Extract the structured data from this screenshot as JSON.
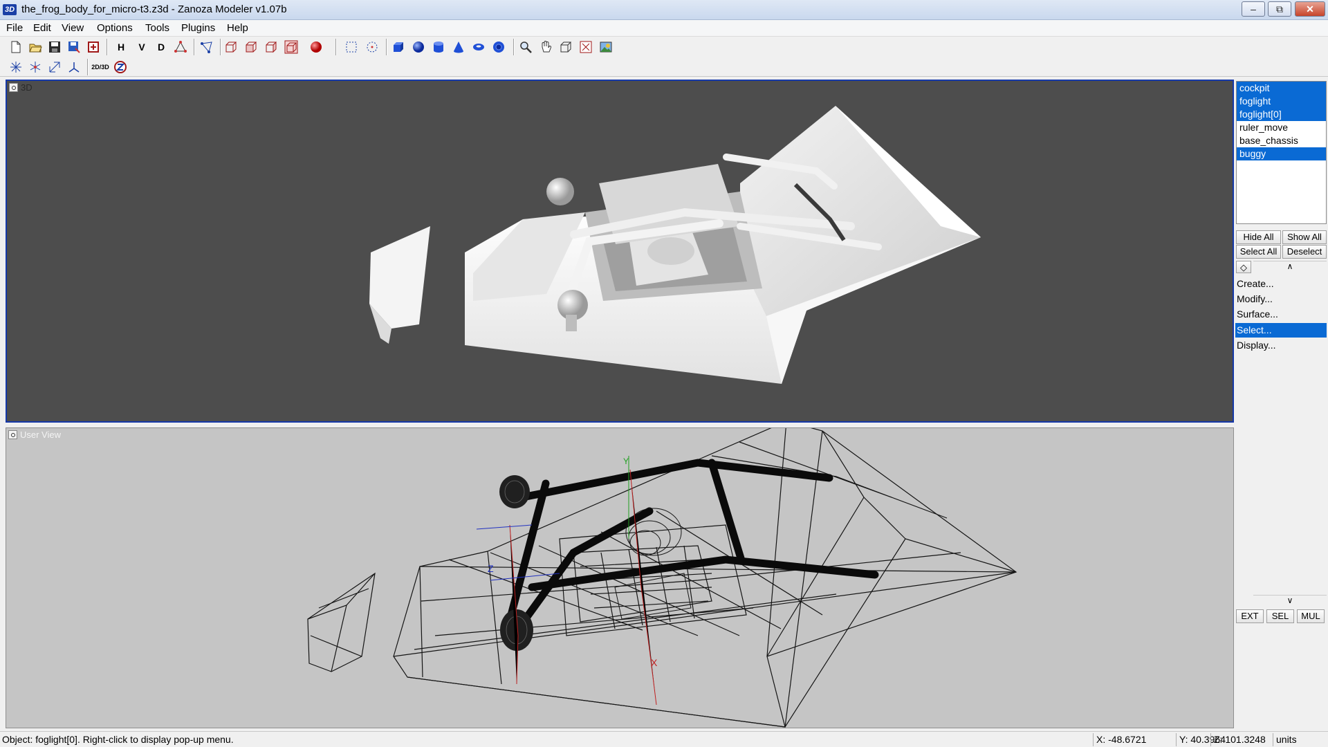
{
  "window": {
    "app_icon": "3D",
    "title": "the_frog_body_for_micro-t3.z3d - Zanoza Modeler v1.07b",
    "controls": [
      "minimize-icon",
      "restore-icon",
      "close-icon"
    ]
  },
  "menu": {
    "items": [
      "File",
      "Edit",
      "View",
      "Options",
      "Tools",
      "Plugins",
      "Help"
    ]
  },
  "toolbar1": {
    "h_label": "H",
    "v_label": "V",
    "d_label": "D",
    "icons": [
      "new-file-icon",
      "open-file-icon",
      "save-icon",
      "save-as-icon",
      "revert-icon",
      "h-toggle-icon",
      "v-toggle-icon",
      "d-toggle-icon",
      "edge-icon",
      "vertex-select-icon",
      "cube-wire-icon",
      "cube-front-icon",
      "cube-side-icon",
      "cube-red-icon",
      "sphere-red-icon",
      "rect-select-icon",
      "circle-select-icon",
      "box-primitive-icon",
      "sphere-primitive-icon",
      "cylinder-primitive-icon",
      "cone-primitive-icon",
      "torus-primitive-icon",
      "capsule-primitive-icon",
      "zoom-icon",
      "pan-hand-icon",
      "frame-icon",
      "fit-icon",
      "render-icon"
    ]
  },
  "toolbar2": {
    "toggle_label": "2D/3D",
    "icons": [
      "move-icon",
      "rotate-icon",
      "scale-icon",
      "axis-icon",
      "toggle-2d-3d-icon",
      "zanoza-icon"
    ]
  },
  "viewports": {
    "top_label": "3D",
    "bottom_label": "User View",
    "axis_labels": {
      "x": "X",
      "y": "Y",
      "z": "Z"
    }
  },
  "objects": [
    {
      "name": "cockpit",
      "selected": true
    },
    {
      "name": "foglight",
      "selected": true
    },
    {
      "name": "foglight[0]",
      "selected": true
    },
    {
      "name": "ruler_move",
      "selected": false
    },
    {
      "name": "base_chassis",
      "selected": false
    },
    {
      "name": "buggy",
      "selected": true
    }
  ],
  "panel": {
    "hide_all": "Hide All",
    "show_all": "Show All",
    "select_all": "Select All",
    "deselect": "Deselect",
    "rollups": [
      "Create...",
      "Modify...",
      "Surface...",
      "Select...",
      "Display..."
    ],
    "active_rollup": "Select...",
    "ext": "EXT",
    "sel": "SEL",
    "mul": "MUL"
  },
  "status": {
    "message": "Object: foglight[0]. Right-click to display pop-up menu.",
    "x": "X: -48.6721",
    "y": "Y: 40.3964",
    "z": "Z: 101.3248",
    "units": "units"
  },
  "colors": {
    "selection": "#0a6ad4",
    "viewport_3d_bg": "#4d4d4d",
    "viewport_user_bg": "#c5c5c5",
    "active_border": "#1538a8"
  }
}
